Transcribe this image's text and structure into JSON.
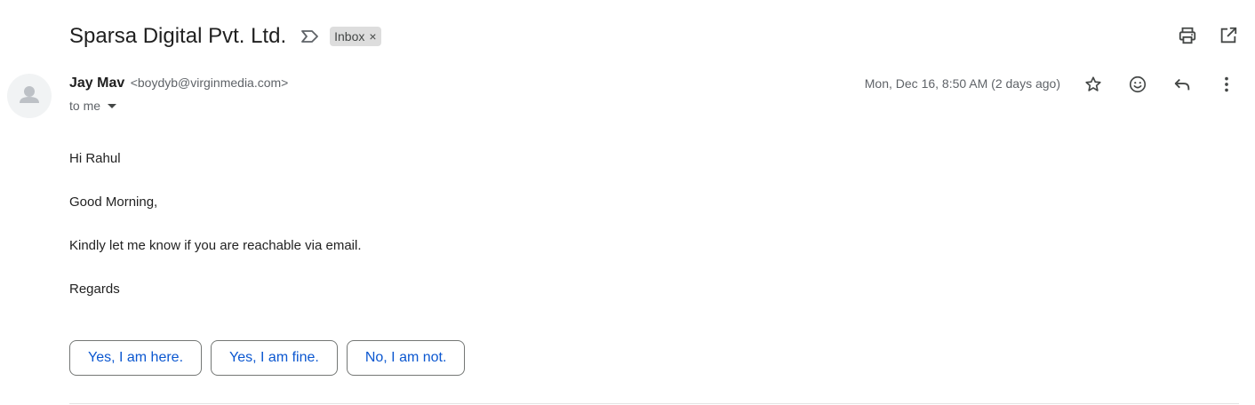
{
  "subject": "Sparsa Digital Pvt. Ltd.",
  "label": {
    "name": "Inbox",
    "remove_glyph": "×"
  },
  "sender": {
    "name": "Jay Mav",
    "email": "<boydyb@virginmedia.com>"
  },
  "recipient": "to me",
  "date": "Mon, Dec 16, 8:50 AM (2 days ago)",
  "body": {
    "lines": [
      "Hi Rahul",
      "Good Morning,",
      "Kindly let me know if you are reachable via email.",
      "Regards"
    ]
  },
  "smart_replies": [
    "Yes, I am here.",
    "Yes, I am fine.",
    "No, I am not."
  ],
  "icons": {
    "top_actions": [
      "print-icon",
      "open-in-new-window-icon"
    ],
    "message_actions": [
      "star-icon",
      "emoji-icon",
      "reply-icon",
      "more-vert-icon"
    ],
    "label_marker": "important-marker-icon"
  },
  "colors": {
    "link_blue": "#0b57d0",
    "label_chip_bg": "#dddddd",
    "text_primary": "#1f1f1f",
    "text_secondary": "#5f6368"
  }
}
